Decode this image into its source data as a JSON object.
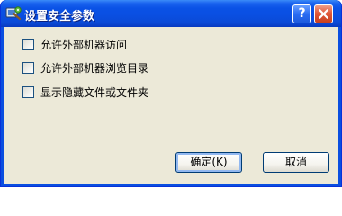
{
  "window": {
    "title": "设置安全参数",
    "help_label": "?"
  },
  "options": [
    {
      "label": "允许外部机器访问",
      "checked": false
    },
    {
      "label": "允许外部机器浏览目录",
      "checked": false
    },
    {
      "label": "显示隐藏文件或文件夹",
      "checked": false
    }
  ],
  "buttons": {
    "ok_label": "确定(K)",
    "cancel_label": "取消"
  },
  "colors": {
    "titlebar": "#0a52e6",
    "client": "#ece9d8",
    "close_button": "#e0583a"
  },
  "icons": {
    "app": "settings-app-icon",
    "help": "help-icon",
    "close": "close-icon"
  }
}
